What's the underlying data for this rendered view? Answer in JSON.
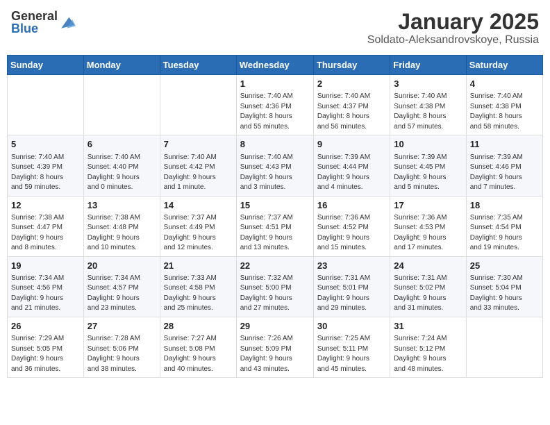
{
  "header": {
    "logo_general": "General",
    "logo_blue": "Blue",
    "title": "January 2025",
    "subtitle": "Soldato-Aleksandrovskoye, Russia"
  },
  "weekdays": [
    "Sunday",
    "Monday",
    "Tuesday",
    "Wednesday",
    "Thursday",
    "Friday",
    "Saturday"
  ],
  "weeks": [
    [
      {
        "day": "",
        "info": ""
      },
      {
        "day": "",
        "info": ""
      },
      {
        "day": "",
        "info": ""
      },
      {
        "day": "1",
        "info": "Sunrise: 7:40 AM\nSunset: 4:36 PM\nDaylight: 8 hours\nand 55 minutes."
      },
      {
        "day": "2",
        "info": "Sunrise: 7:40 AM\nSunset: 4:37 PM\nDaylight: 8 hours\nand 56 minutes."
      },
      {
        "day": "3",
        "info": "Sunrise: 7:40 AM\nSunset: 4:38 PM\nDaylight: 8 hours\nand 57 minutes."
      },
      {
        "day": "4",
        "info": "Sunrise: 7:40 AM\nSunset: 4:38 PM\nDaylight: 8 hours\nand 58 minutes."
      }
    ],
    [
      {
        "day": "5",
        "info": "Sunrise: 7:40 AM\nSunset: 4:39 PM\nDaylight: 8 hours\nand 59 minutes."
      },
      {
        "day": "6",
        "info": "Sunrise: 7:40 AM\nSunset: 4:40 PM\nDaylight: 9 hours\nand 0 minutes."
      },
      {
        "day": "7",
        "info": "Sunrise: 7:40 AM\nSunset: 4:42 PM\nDaylight: 9 hours\nand 1 minute."
      },
      {
        "day": "8",
        "info": "Sunrise: 7:40 AM\nSunset: 4:43 PM\nDaylight: 9 hours\nand 3 minutes."
      },
      {
        "day": "9",
        "info": "Sunrise: 7:39 AM\nSunset: 4:44 PM\nDaylight: 9 hours\nand 4 minutes."
      },
      {
        "day": "10",
        "info": "Sunrise: 7:39 AM\nSunset: 4:45 PM\nDaylight: 9 hours\nand 5 minutes."
      },
      {
        "day": "11",
        "info": "Sunrise: 7:39 AM\nSunset: 4:46 PM\nDaylight: 9 hours\nand 7 minutes."
      }
    ],
    [
      {
        "day": "12",
        "info": "Sunrise: 7:38 AM\nSunset: 4:47 PM\nDaylight: 9 hours\nand 8 minutes."
      },
      {
        "day": "13",
        "info": "Sunrise: 7:38 AM\nSunset: 4:48 PM\nDaylight: 9 hours\nand 10 minutes."
      },
      {
        "day": "14",
        "info": "Sunrise: 7:37 AM\nSunset: 4:49 PM\nDaylight: 9 hours\nand 12 minutes."
      },
      {
        "day": "15",
        "info": "Sunrise: 7:37 AM\nSunset: 4:51 PM\nDaylight: 9 hours\nand 13 minutes."
      },
      {
        "day": "16",
        "info": "Sunrise: 7:36 AM\nSunset: 4:52 PM\nDaylight: 9 hours\nand 15 minutes."
      },
      {
        "day": "17",
        "info": "Sunrise: 7:36 AM\nSunset: 4:53 PM\nDaylight: 9 hours\nand 17 minutes."
      },
      {
        "day": "18",
        "info": "Sunrise: 7:35 AM\nSunset: 4:54 PM\nDaylight: 9 hours\nand 19 minutes."
      }
    ],
    [
      {
        "day": "19",
        "info": "Sunrise: 7:34 AM\nSunset: 4:56 PM\nDaylight: 9 hours\nand 21 minutes."
      },
      {
        "day": "20",
        "info": "Sunrise: 7:34 AM\nSunset: 4:57 PM\nDaylight: 9 hours\nand 23 minutes."
      },
      {
        "day": "21",
        "info": "Sunrise: 7:33 AM\nSunset: 4:58 PM\nDaylight: 9 hours\nand 25 minutes."
      },
      {
        "day": "22",
        "info": "Sunrise: 7:32 AM\nSunset: 5:00 PM\nDaylight: 9 hours\nand 27 minutes."
      },
      {
        "day": "23",
        "info": "Sunrise: 7:31 AM\nSunset: 5:01 PM\nDaylight: 9 hours\nand 29 minutes."
      },
      {
        "day": "24",
        "info": "Sunrise: 7:31 AM\nSunset: 5:02 PM\nDaylight: 9 hours\nand 31 minutes."
      },
      {
        "day": "25",
        "info": "Sunrise: 7:30 AM\nSunset: 5:04 PM\nDaylight: 9 hours\nand 33 minutes."
      }
    ],
    [
      {
        "day": "26",
        "info": "Sunrise: 7:29 AM\nSunset: 5:05 PM\nDaylight: 9 hours\nand 36 minutes."
      },
      {
        "day": "27",
        "info": "Sunrise: 7:28 AM\nSunset: 5:06 PM\nDaylight: 9 hours\nand 38 minutes."
      },
      {
        "day": "28",
        "info": "Sunrise: 7:27 AM\nSunset: 5:08 PM\nDaylight: 9 hours\nand 40 minutes."
      },
      {
        "day": "29",
        "info": "Sunrise: 7:26 AM\nSunset: 5:09 PM\nDaylight: 9 hours\nand 43 minutes."
      },
      {
        "day": "30",
        "info": "Sunrise: 7:25 AM\nSunset: 5:11 PM\nDaylight: 9 hours\nand 45 minutes."
      },
      {
        "day": "31",
        "info": "Sunrise: 7:24 AM\nSunset: 5:12 PM\nDaylight: 9 hours\nand 48 minutes."
      },
      {
        "day": "",
        "info": ""
      }
    ]
  ]
}
